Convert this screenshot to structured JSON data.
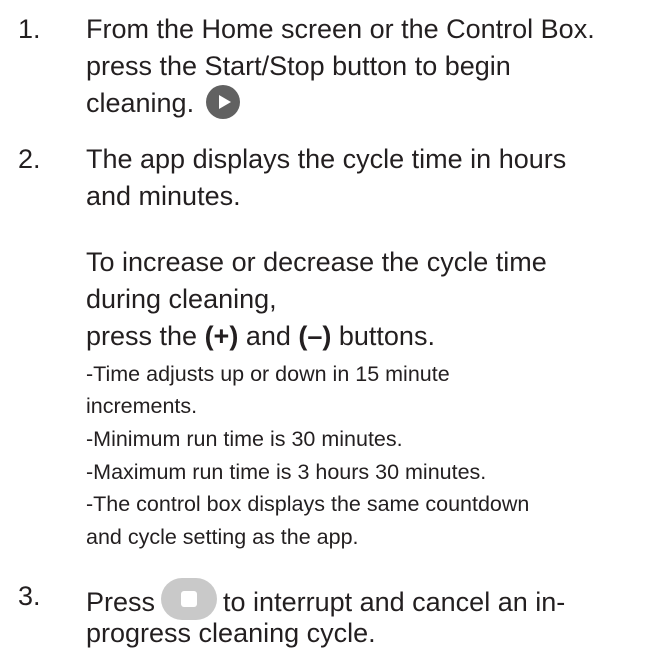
{
  "steps": [
    {
      "number": "1.",
      "lines": [
        "From the Home screen or the Control Box.",
        "press the Start/Stop button to begin",
        "cleaning."
      ],
      "icon": "play-button-icon"
    },
    {
      "number": "2.",
      "lines": [
        "The app displays the cycle time in hours",
        "and minutes."
      ],
      "detail": {
        "lines": [
          "To increase or decrease the cycle time",
          "during cleaning,"
        ],
        "press_prefix": "press the ",
        "plus": "(+)",
        "and_word": " and ",
        "minus": "(–)",
        "buttons_suffix": " buttons.",
        "notes": [
          "-Time adjusts up or down in 15 minute",
          "increments.",
          "-Minimum run time is 30 minutes.",
          "-Maximum run time is 3 hours 30 minutes.",
          "-The control box displays the same countdown",
          "and cycle setting as the app."
        ]
      }
    },
    {
      "number": "3.",
      "prefix": "Press",
      "icon": "stop-button-icon",
      "suffix": "to interrupt and cancel an in-",
      "line2": "progress cleaning cycle."
    }
  ],
  "colors": {
    "text": "#231f20",
    "play_icon": "#616161",
    "stop_icon": "#c9c9c9"
  }
}
